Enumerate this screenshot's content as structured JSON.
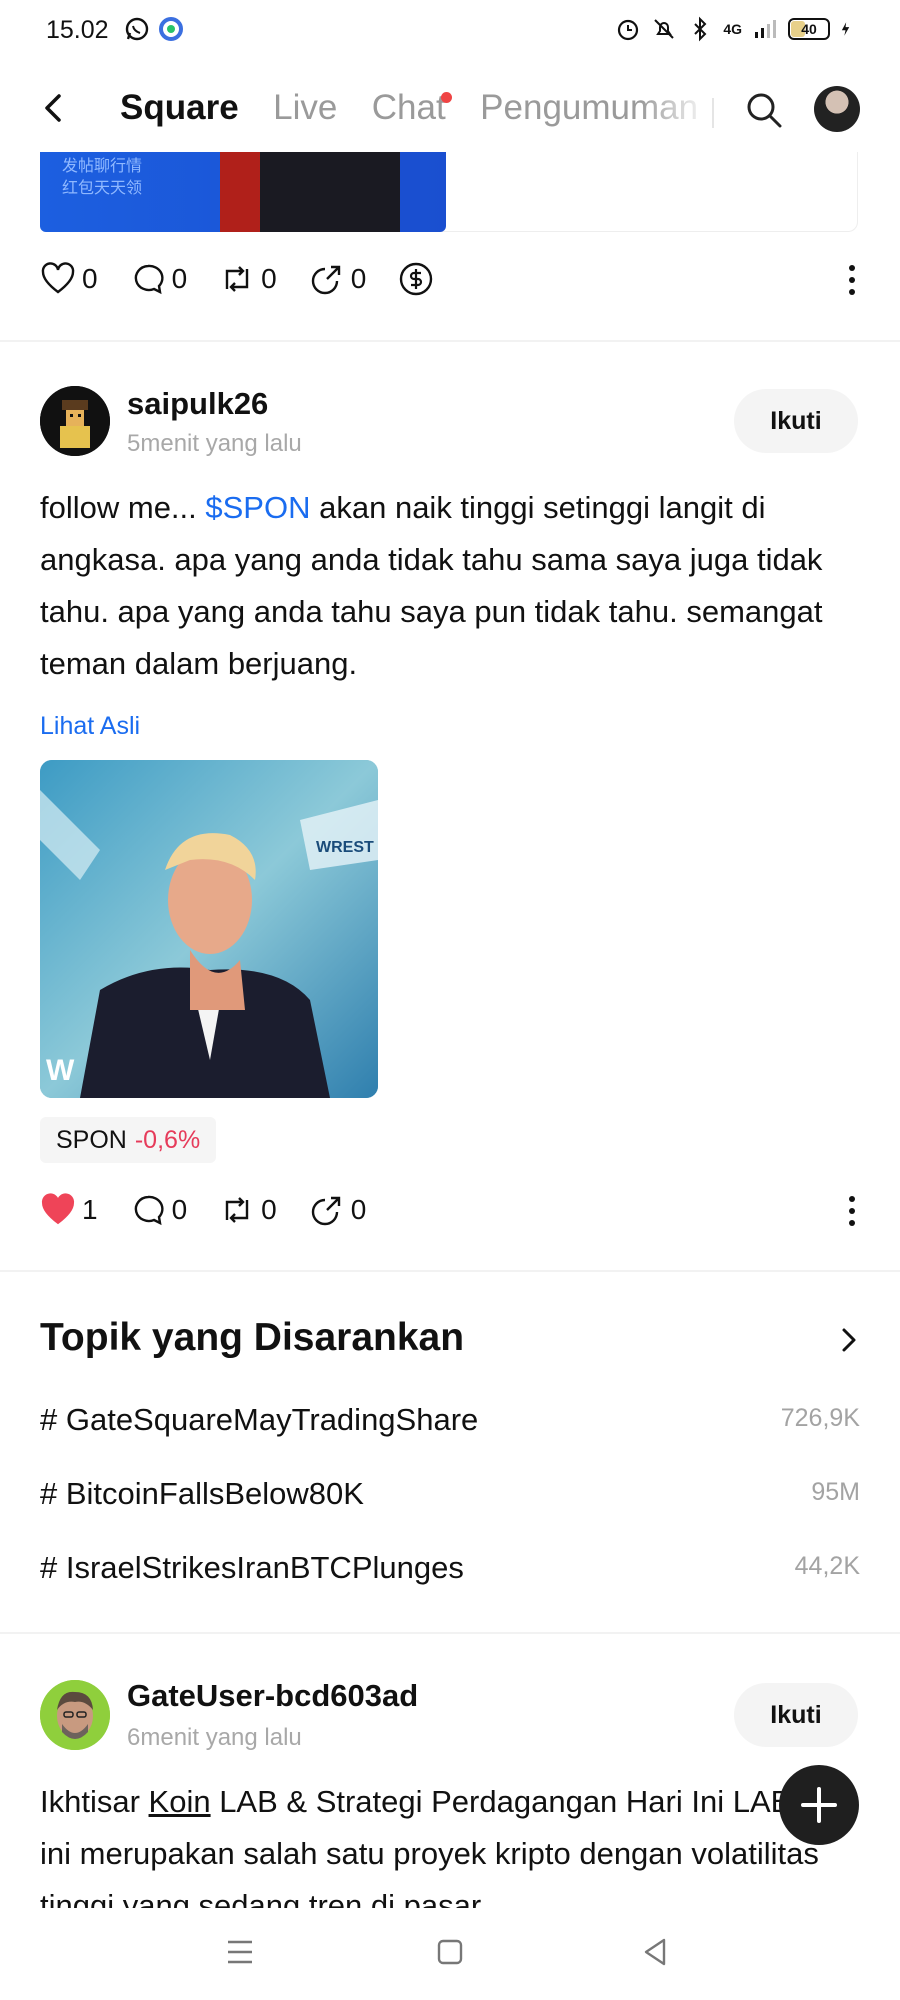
{
  "status_bar": {
    "time": "15.02",
    "left_icons": [
      "whatsapp-icon",
      "app-notification-icon"
    ],
    "right_icons": [
      "alarm-icon",
      "mute-icon",
      "bluetooth-icon",
      "signal-icon"
    ],
    "network": "4G",
    "battery": "40"
  },
  "nav": {
    "tabs": [
      {
        "label": "Square",
        "active": true
      },
      {
        "label": "Live",
        "active": false
      },
      {
        "label": "Chat",
        "active": false,
        "dot": true
      },
      {
        "label": "Pengumuman",
        "active": false
      }
    ]
  },
  "banner": {
    "text_line1": "发帖聊行情",
    "text_line2": "红包天天领"
  },
  "post_prev_actions": {
    "likes": "0",
    "comments": "0",
    "reposts": "0",
    "shares": "0"
  },
  "post1": {
    "username": "saipulk26",
    "time": "5menit yang lalu",
    "follow_label": "Ikuti",
    "body_before": "follow me... ",
    "cashtag": "$SPON",
    "body_after": "  akan naik tinggi setinggi langit di angkasa. apa yang anda tidak tahu sama saya juga tidak tahu. apa yang anda tahu saya pun tidak tahu. semangat teman dalam berjuang.",
    "see_original": "Lihat Asli",
    "coin": "SPON",
    "coin_change": "-0,6%",
    "likes": "1",
    "comments": "0",
    "reposts": "0",
    "shares": "0",
    "image_logo": "W",
    "image_sign": "WREST"
  },
  "topics": {
    "title": "Topik yang Disarankan",
    "items": [
      {
        "name": "# GateSquareMayTradingShare",
        "count": "726,9K"
      },
      {
        "name": "# BitcoinFallsBelow80K",
        "count": "95M"
      },
      {
        "name": "# IsraelStrikesIranBTCPlunges",
        "count": "44,2K"
      }
    ]
  },
  "post2": {
    "username": "GateUser-bcd603ad",
    "time": "6menit yang lalu",
    "follow_label": "Ikuti",
    "body_pre": "Ikhtisar ",
    "body_underlined": "Koin",
    "body_post": " LAB & Strategi Perdagangan Hari Ini LAB saat ini merupakan salah satu proyek kripto dengan volatilitas tinggi yang sedang tren di pasar"
  },
  "colors": {
    "accent_blue": "#1a6cf0",
    "negative_red": "#e63b5a",
    "like_red": "#ef4444"
  }
}
